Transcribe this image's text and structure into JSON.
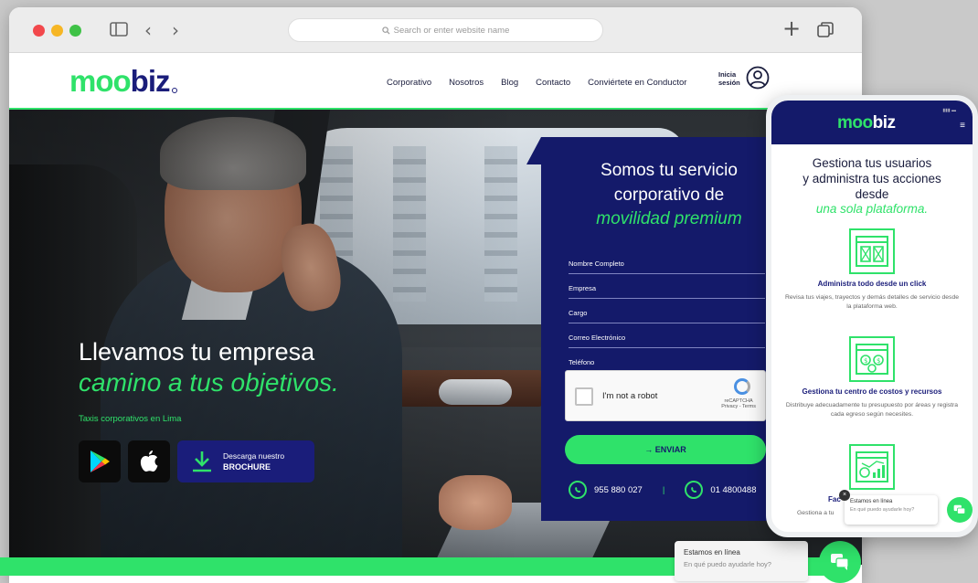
{
  "browser": {
    "url_placeholder": "Search or enter website name",
    "plus_label": "+"
  },
  "header": {
    "logo_m": "moo",
    "logo_b": "biz",
    "nav": [
      "Corporativo",
      "Nosotros",
      "Blog",
      "Contacto",
      "Conviértete en Conductor"
    ],
    "login_line1": "Inicia",
    "login_line2": "sesión"
  },
  "hero": {
    "title_line1": "Llevamos tu empresa",
    "title_line2": "camino a tus objetivos.",
    "tagline": "Taxis corporativos en Lima",
    "brochure_line1": "Descarga nuestro",
    "brochure_line2": "BROCHURE"
  },
  "form": {
    "heading_line1": "Somos tu servicio",
    "heading_line2": "corporativo de",
    "heading_line3": "movilidad premium",
    "fields": [
      "Nombre Completo",
      "Empresa",
      "Cargo",
      "Correo Electrónico",
      "Teléfono"
    ],
    "captcha_label": "I'm not a robot",
    "captcha_brand": "reCAPTCHA",
    "captcha_terms": "Privacy - Terms",
    "submit_label": "→ ENVIAR",
    "phone1": "955 880 027",
    "phone_sep": "|",
    "phone2": "01 4800488"
  },
  "chat": {
    "title": "Estamos en línea",
    "subtitle": "En qué puedo ayudarle hoy?"
  },
  "mobile": {
    "logo_m": "moo",
    "logo_b": "biz",
    "title_line1": "Gestiona tus usuarios",
    "title_line2": "y administra tus acciones",
    "title_line3": "desde",
    "title_em": "una sola plataforma.",
    "features": [
      {
        "title": "Administra todo desde un click",
        "text": "Revisa tus viajes, trayectos y demás detalles de servicio desde la plataforma web."
      },
      {
        "title": "Gestiona tu centro de costos y recursos",
        "text": "Distribuye adecuadamente tu presupuesto por áreas y registra cada egreso según necesites."
      },
      {
        "title": "Fac",
        "text": "Gestiona a tu"
      }
    ],
    "chat_title": "Estamos en línea",
    "chat_subtitle": "En qué puedo ayudarle hoy?",
    "chat_close": "×"
  },
  "colors": {
    "brand_green": "#2fe26a",
    "brand_navy": "#141a6a"
  }
}
